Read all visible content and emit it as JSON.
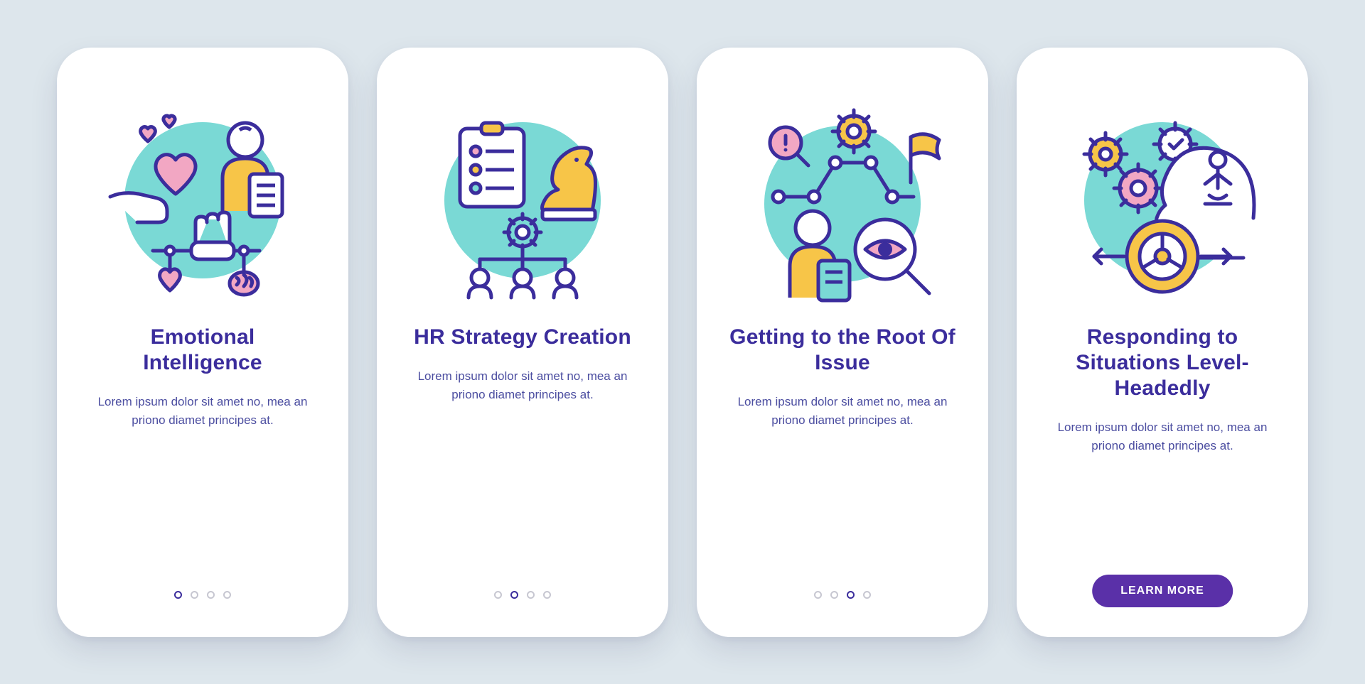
{
  "colors": {
    "background": "#dde6ec",
    "card": "#ffffff",
    "primary": "#3b2d9c",
    "button": "#5a30a8",
    "teal": "#7ad9d5",
    "yellow": "#f7c548",
    "pink": "#f2a7c3",
    "dot_inactive": "#c7c7d1"
  },
  "button_label": "LEARN MORE",
  "screens": [
    {
      "title": "Emotional Intelligence",
      "body": "Lorem ipsum dolor sit amet no, mea an priono diamet principes at.",
      "icon": "emotional-intelligence-icon",
      "active_dot": 0
    },
    {
      "title": "HR Strategy Creation",
      "body": "Lorem ipsum dolor sit amet no, mea an priono diamet principes at.",
      "icon": "hr-strategy-icon",
      "active_dot": 1
    },
    {
      "title": "Getting to the Root Of Issue",
      "body": "Lorem ipsum dolor sit amet no, mea an priono diamet principes at.",
      "icon": "root-issue-icon",
      "active_dot": 2
    },
    {
      "title": "Responding to Situations Level-Headedly",
      "body": "Lorem ipsum dolor sit amet no, mea an priono diamet principes at.",
      "icon": "level-headed-icon",
      "active_dot": 3
    }
  ]
}
